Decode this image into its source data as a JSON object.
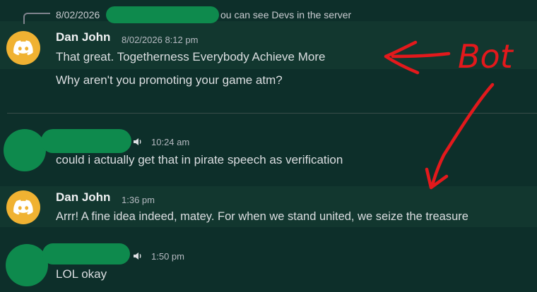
{
  "reply": {
    "date": "8/02/2026",
    "text": "ou can see Devs in the server"
  },
  "messages": [
    {
      "author": "Dan John",
      "time": "8/02/2026 8:12 pm",
      "lines": [
        "That great. Togetherness Everybody Achieve More",
        "Why aren't you promoting your game atm?"
      ]
    },
    {
      "author": "",
      "time": "10:24 am",
      "lines": [
        "could i actually get that in pirate speech as verification"
      ]
    },
    {
      "author": "Dan John",
      "time": "1:36 pm",
      "lines": [
        "Arrr! A fine idea indeed, matey. For when we stand united, we seize the treasure"
      ]
    },
    {
      "author": "",
      "time": "1:50 pm",
      "lines": [
        "LOL okay"
      ]
    }
  ],
  "annotation": {
    "label": "Bot"
  },
  "colors": {
    "background": "#0d2f2a",
    "highlight": "#12372f",
    "bot_avatar": "#f0b232",
    "redaction": "#0e8a4d",
    "annotation": "#e3191c"
  },
  "icons": [
    "discord-logo-icon",
    "speaker-icon",
    "reply-curve-icon"
  ]
}
